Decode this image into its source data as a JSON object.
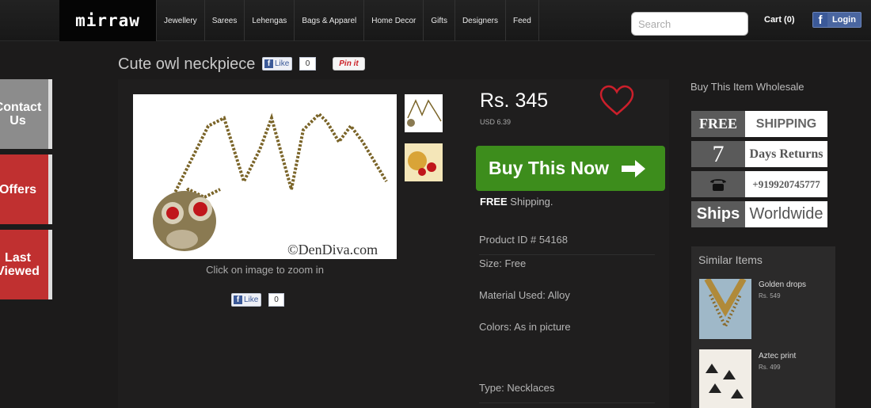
{
  "header": {
    "logo": "mirraw",
    "nav": [
      "Jewellery",
      "Sarees",
      "Lehengas",
      "Bags & Apparel",
      "Home Decor",
      "Gifts",
      "Designers",
      "Feed"
    ],
    "search_placeholder": "Search",
    "cart_label": "Cart (0)",
    "login_label": "Login"
  },
  "side_tabs": {
    "contact": "Contact Us",
    "offers": "Offers",
    "last_viewed": "Last Viewed"
  },
  "product": {
    "title": "Cute owl neckpiece",
    "like_label": "Like",
    "like_count": "0",
    "pin_label": "Pin it",
    "image_caption": "©DenDiva.com",
    "zoom_hint": "Click on image to zoom in",
    "price": "Rs. 345",
    "usd_price": "USD 6.39",
    "buy_label": "Buy This Now",
    "free_label": "FREE",
    "shipping_text": " Shipping.",
    "details": {
      "product_id": "Product ID # 54168",
      "size": "Size: Free",
      "material": "Material Used: Alloy",
      "colors": "Colors: As in picture",
      "type": "Type: Necklaces"
    }
  },
  "sidebar": {
    "wholesale_link": "Buy This Item Wholesale",
    "badges": {
      "free": "FREE",
      "shipping": "SHIPPING",
      "days_num": "7",
      "days_returns": "Days Returns",
      "phone": "+919920745777",
      "ships": "Ships",
      "worldwide": "Worldwide"
    },
    "similar_title": "Similar Items",
    "similar_items": [
      {
        "name": "Golden drops",
        "price": "Rs. 549"
      },
      {
        "name": "Aztec print",
        "price": "Rs. 499"
      }
    ]
  },
  "colors": {
    "buy_green": "#3d8d1c",
    "tab_red": "#c03030",
    "heart_red": "#cc1f2b"
  }
}
